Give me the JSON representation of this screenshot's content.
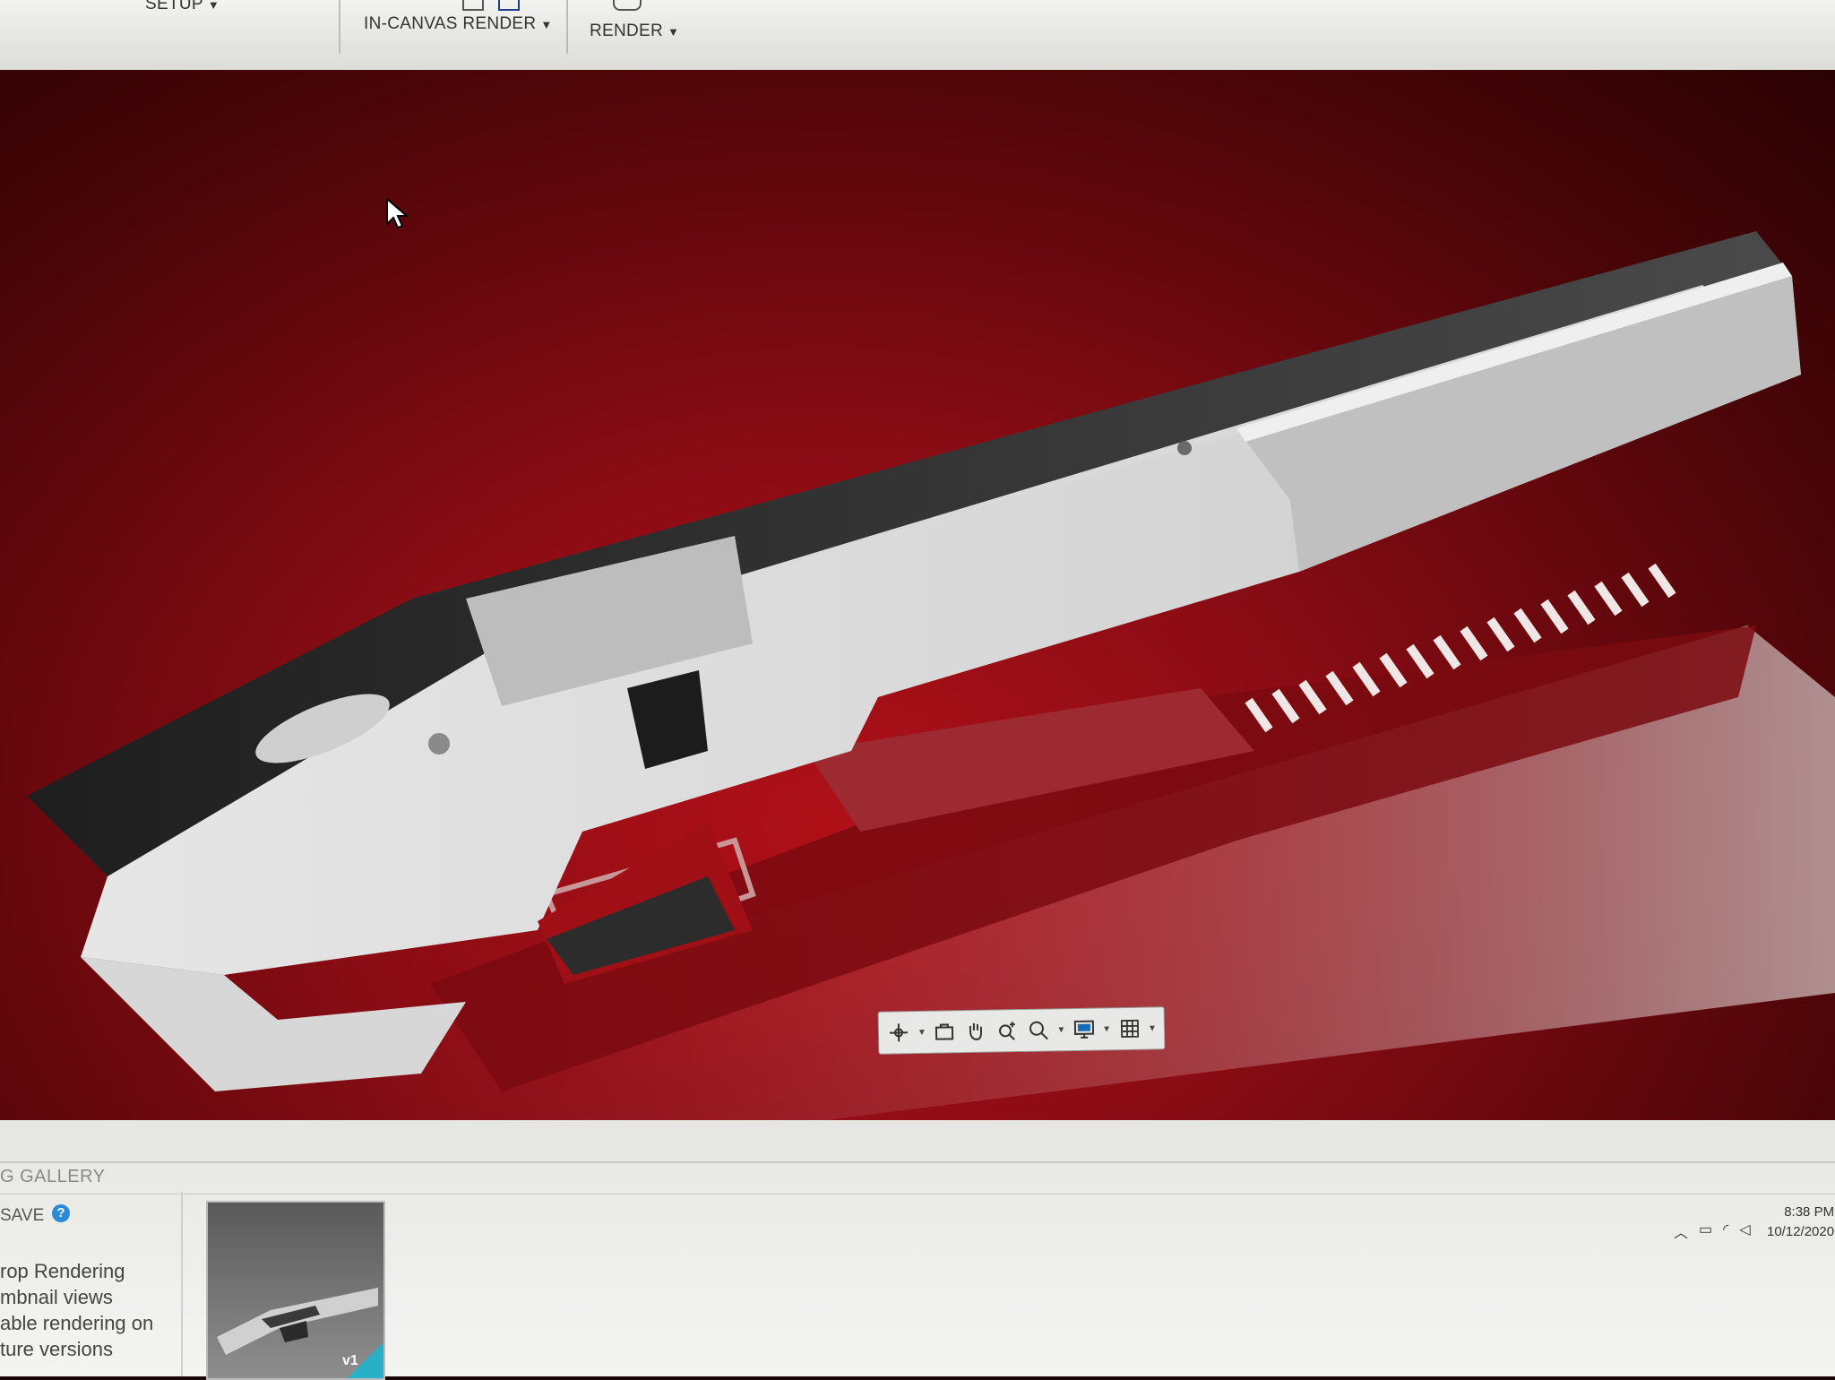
{
  "ribbon": {
    "tabs": [
      {
        "label": "SETUP"
      },
      {
        "label": "IN-CANVAS RENDER"
      },
      {
        "label": "RENDER"
      }
    ]
  },
  "viewport": {
    "background_color": "#9e0f16",
    "model_color": "#d8d8d8",
    "nav_tools": [
      "orbit-icon",
      "look-at-icon",
      "pan-icon",
      "zoom-icon",
      "fit-icon",
      "display-settings-icon",
      "grid-icon"
    ]
  },
  "gallery": {
    "title": "G GALLERY",
    "save_label": "SAVE",
    "description_lines": [
      "rop Rendering",
      "mbnail views",
      "able rendering on",
      "ture versions"
    ],
    "thumbnail_version": "v1"
  },
  "system_tray": {
    "time": "8:38 PM",
    "date": "10/12/2020"
  }
}
